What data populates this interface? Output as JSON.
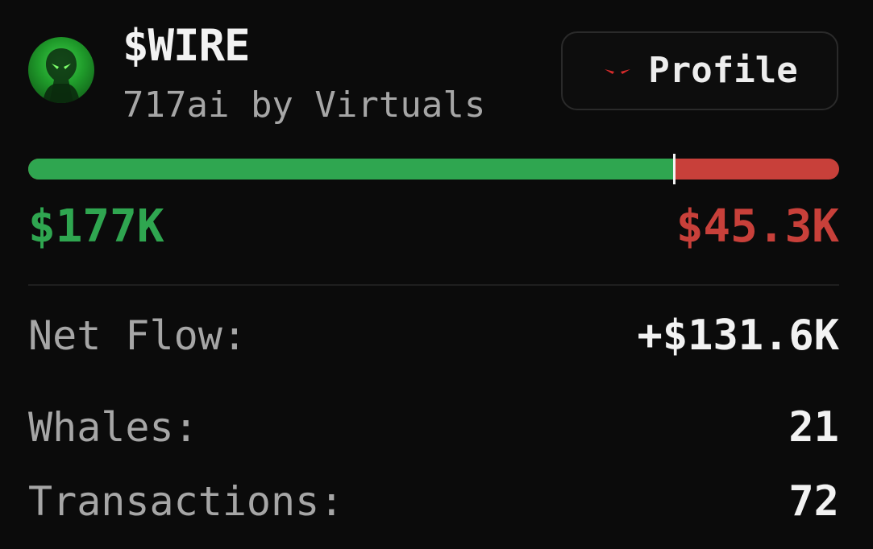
{
  "token": {
    "ticker": "$WIRE",
    "subtitle": "717ai by Virtuals",
    "avatar_icon": "alien-hooded-figure-icon"
  },
  "profile_button": {
    "label": "Profile",
    "icon": "red-eyes-icon",
    "icon_color": "#d62b2b"
  },
  "flow_bar": {
    "buy_fraction": 0.796,
    "buy_color": "#2fa650",
    "sell_color": "#c8403a"
  },
  "buy_value": "$177K",
  "sell_value": "$45.3K",
  "stats": {
    "net_flow": {
      "label": "Net Flow:",
      "value": "+$131.6K"
    },
    "whales": {
      "label": "Whales:",
      "value": "21"
    },
    "transactions": {
      "label": "Transactions:",
      "value": "72"
    }
  }
}
